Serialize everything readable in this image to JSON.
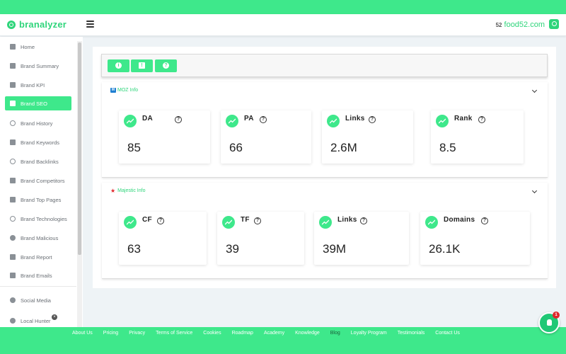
{
  "header": {
    "logo_text": "branalyzer",
    "domain_favicon": "52",
    "domain": "food52.com",
    "search_icon": "search-icon"
  },
  "sidebar": {
    "items": [
      {
        "label": "Home",
        "icon": "home-icon"
      },
      {
        "label": "Brand Summary",
        "icon": "summary-icon"
      },
      {
        "label": "Brand KPI",
        "icon": "kpi-icon"
      },
      {
        "label": "Brand SEO",
        "icon": "seo-icon",
        "active": true
      },
      {
        "label": "Brand History",
        "icon": "history-icon"
      },
      {
        "label": "Brand Keywords",
        "icon": "keyboard-icon"
      },
      {
        "label": "Brand Backlinks",
        "icon": "link-icon"
      },
      {
        "label": "Brand Competitors",
        "icon": "building-icon"
      },
      {
        "label": "Brand Top Pages",
        "icon": "layers-icon"
      },
      {
        "label": "Brand Technologies",
        "icon": "target-icon"
      },
      {
        "label": "Brand Malicious",
        "icon": "close-circle-icon"
      },
      {
        "label": "Brand Report",
        "icon": "report-icon"
      },
      {
        "label": "Brand Emails",
        "icon": "mail-icon"
      },
      {
        "label": "Social Media",
        "icon": "social-icon"
      },
      {
        "label": "Local Hunter",
        "icon": "location-icon"
      }
    ]
  },
  "toolbar": {
    "buttons": [
      {
        "icon": "info-icon",
        "glyph": "i"
      },
      {
        "icon": "feedback-icon",
        "glyph": "!"
      },
      {
        "icon": "help-icon",
        "glyph": "?"
      }
    ]
  },
  "moz": {
    "title": "MOZ Info",
    "icon_text": "M",
    "cards": [
      {
        "label": "DA",
        "value": "85"
      },
      {
        "label": "PA",
        "value": "66"
      },
      {
        "label": "Links",
        "value": "2.6M"
      },
      {
        "label": "Rank",
        "value": "8.5"
      }
    ]
  },
  "majestic": {
    "title": "Majestic Info",
    "cards": [
      {
        "label": "CF",
        "value": "63"
      },
      {
        "label": "TF",
        "value": "39"
      },
      {
        "label": "Links",
        "value": "39M"
      },
      {
        "label": "Domains",
        "value": "26.1K"
      }
    ]
  },
  "footer": {
    "links": [
      "About Us",
      "Pricing",
      "Privacy",
      "Terms of Service",
      "Cookies",
      "Roadmap",
      "Academy",
      "Knowledge",
      "Blog",
      "Loyalty Program",
      "Testimonials",
      "Contact Us"
    ],
    "current": "Blog"
  },
  "chat": {
    "badge": "1"
  },
  "colors": {
    "accent": "#3ee88b",
    "accent_text": "#2fd57b",
    "moz_blue": "#1f7fd1",
    "majestic_red": "#e0262b"
  }
}
